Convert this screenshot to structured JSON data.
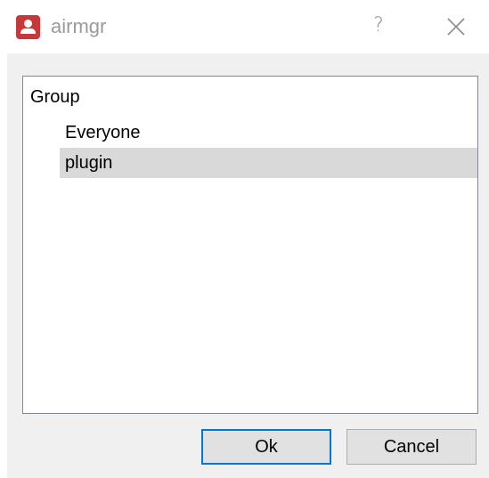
{
  "window": {
    "title": "airmgr",
    "help_glyph": "?",
    "icons": {
      "app": "user-icon",
      "close": "close-icon"
    },
    "accent_color": "#0078d7",
    "icon_color": "#c6393b"
  },
  "tree": {
    "root_label": "Group",
    "items": [
      {
        "label": "Everyone",
        "selected": false
      },
      {
        "label": "plugin",
        "selected": true
      }
    ],
    "selection_color": "#d9d9d9"
  },
  "buttons": {
    "ok_label": "Ok",
    "cancel_label": "Cancel"
  }
}
